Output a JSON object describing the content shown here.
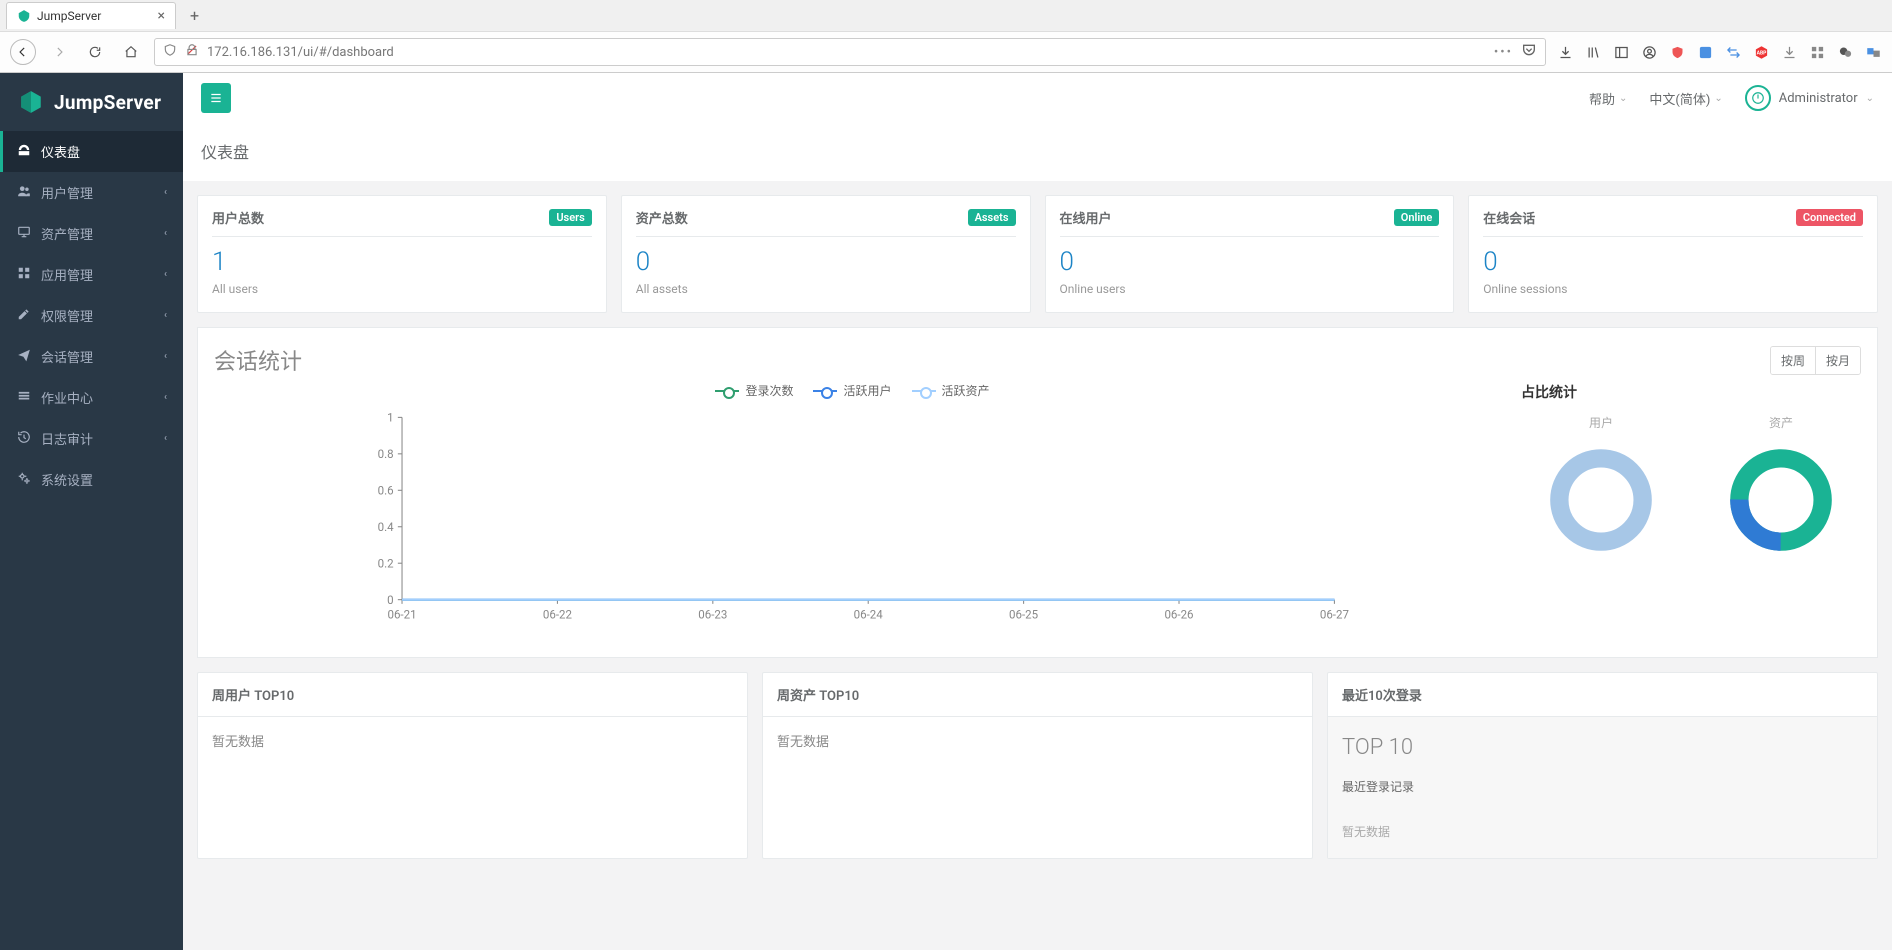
{
  "browser": {
    "tab_title": "JumpServer",
    "url": "172.16.186.131/ui/#/dashboard"
  },
  "app": {
    "logo_text": "JumpServer",
    "page_title": "仪表盘",
    "topbar": {
      "help": "帮助",
      "lang": "中文(简体)",
      "user": "Administrator"
    },
    "sidebar": [
      {
        "label": "仪表盘",
        "icon": "dashboard",
        "expandable": false,
        "active": true
      },
      {
        "label": "用户管理",
        "icon": "users",
        "expandable": true,
        "active": false
      },
      {
        "label": "资产管理",
        "icon": "desktop",
        "expandable": true,
        "active": false
      },
      {
        "label": "应用管理",
        "icon": "grid",
        "expandable": true,
        "active": false
      },
      {
        "label": "权限管理",
        "icon": "edit",
        "expandable": true,
        "active": false
      },
      {
        "label": "会话管理",
        "icon": "send",
        "expandable": true,
        "active": false
      },
      {
        "label": "作业中心",
        "icon": "stack",
        "expandable": true,
        "active": false
      },
      {
        "label": "日志审计",
        "icon": "history",
        "expandable": true,
        "active": false
      },
      {
        "label": "系统设置",
        "icon": "cogs",
        "expandable": false,
        "active": false
      }
    ],
    "stats": [
      {
        "title": "用户总数",
        "badge": "Users",
        "badge_color": "teal",
        "value": "1",
        "sub": "All users"
      },
      {
        "title": "资产总数",
        "badge": "Assets",
        "badge_color": "teal",
        "value": "0",
        "sub": "All assets"
      },
      {
        "title": "在线用户",
        "badge": "Online",
        "badge_color": "teal",
        "value": "0",
        "sub": "Online users"
      },
      {
        "title": "在线会话",
        "badge": "Connected",
        "badge_color": "red",
        "value": "0",
        "sub": "Online sessions"
      }
    ],
    "chart": {
      "title": "会话统计",
      "toggle_week": "按周",
      "toggle_month": "按月",
      "legend": {
        "logins": "登录次数",
        "active_users": "活跃用户",
        "active_assets": "活跃资产"
      },
      "ratio": {
        "title": "占比统计",
        "users": "用户",
        "assets": "资产"
      }
    },
    "bottom": {
      "week_users_title": "周用户 TOP10",
      "week_assets_title": "周资产 TOP10",
      "recent_logins_title": "最近10次登录",
      "no_data": "暂无数据",
      "top10_big": "TOP 10",
      "top10_sub": "最近登录记录",
      "top10_empty": "暂无数据"
    }
  },
  "chart_data": {
    "type": "line",
    "categories": [
      "06-21",
      "06-22",
      "06-23",
      "06-24",
      "06-25",
      "06-26",
      "06-27"
    ],
    "series": [
      {
        "name": "登录次数",
        "values": [
          0,
          0,
          0,
          0,
          0,
          0,
          0
        ]
      },
      {
        "name": "活跃用户",
        "values": [
          0,
          0,
          0,
          0,
          0,
          0,
          0
        ]
      },
      {
        "name": "活跃资产",
        "values": [
          0,
          0,
          0,
          0,
          0,
          0,
          0
        ]
      }
    ],
    "ylim": [
      0,
      1
    ],
    "yticks": [
      0,
      0.2,
      0.4,
      0.6,
      0.8,
      1
    ]
  }
}
